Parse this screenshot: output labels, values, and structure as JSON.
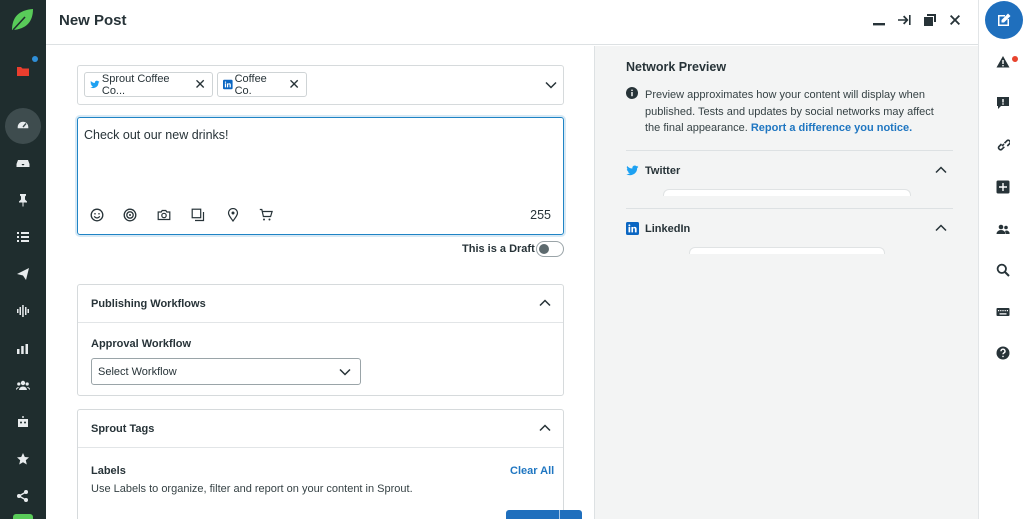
{
  "header": {
    "title": "New Post"
  },
  "profiles": {
    "items": [
      {
        "network": "twitter",
        "label": "Sprout Coffee Co...",
        "icon": "twitter-icon",
        "color": "#1da1f2"
      },
      {
        "network": "linkedin",
        "label": "Coffee Co.",
        "icon": "linkedin-icon",
        "color": "#0a66c2"
      }
    ]
  },
  "editor": {
    "text": "Check out our new drinks!",
    "char_count": "255",
    "tools": [
      "emoji-icon",
      "target-icon",
      "camera-icon",
      "gallery-icon",
      "location-icon",
      "cart-icon"
    ]
  },
  "draft": {
    "label": "This is a Draft",
    "checked": false
  },
  "workflows": {
    "title": "Publishing Workflows",
    "field_label": "Approval Workflow",
    "select_value": "Select Workflow"
  },
  "tags": {
    "title": "Sprout Tags",
    "labels_heading": "Labels",
    "clear_all": "Clear All",
    "description": "Use Labels to organize, filter and report on your content in Sprout."
  },
  "preview": {
    "title": "Network Preview",
    "info_text": "Preview approximates how your content will display when published. Tests and updates by social networks may affect the final appearance.",
    "info_link": "Report a difference you notice.",
    "networks": [
      {
        "label": "Twitter",
        "icon": "twitter-icon"
      },
      {
        "label": "LinkedIn",
        "icon": "linkedin-icon"
      }
    ]
  },
  "colors": {
    "nav_bg": "#1f2d2e",
    "accent": "#1f6fbd",
    "brand": "#59cb59",
    "alert": "#e8442e"
  }
}
